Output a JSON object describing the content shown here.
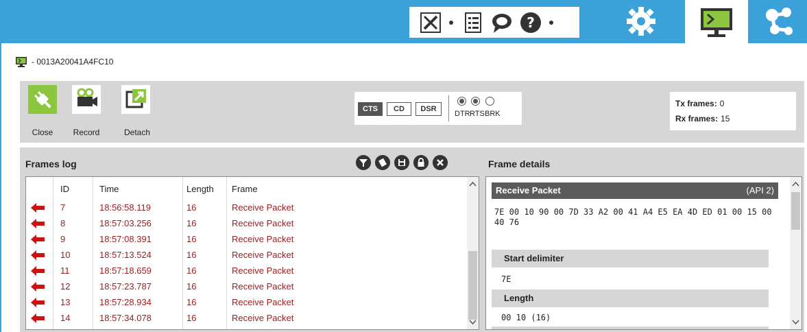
{
  "device": {
    "address": "- 0013A20041A4FC10"
  },
  "controls": {
    "close_label": "Close",
    "record_label": "Record",
    "detach_label": "Detach",
    "lines": {
      "cts": "CTS",
      "cd": "CD",
      "dsr": "DSR",
      "dtr": "DTR",
      "rts": "RTS",
      "brk": "BRK"
    },
    "tx_label": "Tx frames:",
    "tx_value": "0",
    "rx_label": "Rx frames:",
    "rx_value": "15"
  },
  "frames_log": {
    "title": "Frames log",
    "columns": {
      "id": "ID",
      "time": "Time",
      "length": "Length",
      "frame": "Frame"
    },
    "rows": [
      {
        "id": "7",
        "time": "18:56:58.119",
        "length": "16",
        "frame": "Receive Packet"
      },
      {
        "id": "8",
        "time": "18:57:03.256",
        "length": "16",
        "frame": "Receive Packet"
      },
      {
        "id": "9",
        "time": "18:57:08.391",
        "length": "16",
        "frame": "Receive Packet"
      },
      {
        "id": "10",
        "time": "18:57:13.524",
        "length": "16",
        "frame": "Receive Packet"
      },
      {
        "id": "11",
        "time": "18:57:18.659",
        "length": "16",
        "frame": "Receive Packet"
      },
      {
        "id": "12",
        "time": "18:57:23.787",
        "length": "16",
        "frame": "Receive Packet"
      },
      {
        "id": "13",
        "time": "18:57:28.934",
        "length": "16",
        "frame": "Receive Packet"
      },
      {
        "id": "14",
        "time": "18:57:34.078",
        "length": "16",
        "frame": "Receive Packet"
      }
    ]
  },
  "frame_details": {
    "title": "Frame details",
    "header_name": "Receive Packet",
    "header_api": "(API 2)",
    "hex": "7E 00 10 90 00 7D 33 A2 00 41 A4 E5 EA 4D ED 01 00 15 00 40 76",
    "start_delimiter_label": "Start delimiter",
    "start_delimiter_value": "7E",
    "length_label": "Length",
    "length_value": "00 10 (16)"
  },
  "colors": {
    "accent": "#3aa1d9",
    "panel": "#d6d6d6",
    "frame_text": "#9b1c1c",
    "arrow": "#cc1111",
    "active_green": "#8cc63f"
  }
}
